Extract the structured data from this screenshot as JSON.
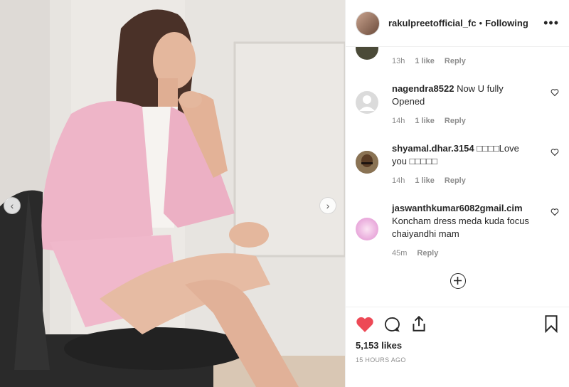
{
  "header": {
    "username": "rakulpreetofficial_fc",
    "separator": "•",
    "follow_status": "Following",
    "more_label": "•••"
  },
  "top_meta": {
    "time": "13h",
    "likes": "1 like",
    "reply": "Reply"
  },
  "comments": [
    {
      "username": "nagendra8522",
      "line1": "Now U fully",
      "line2": "Opened",
      "time": "14h",
      "likes": "1 like",
      "reply": "Reply"
    },
    {
      "username": "shyamal.dhar.3154",
      "line1": "□□□□Love",
      "line2": "you □□□□□",
      "time": "14h",
      "likes": "1 like",
      "reply": "Reply"
    },
    {
      "username": "jaswanthkumar6082gmail.cim",
      "line1": "Koncham dress meda kuda focus",
      "line2": "chaiyandhi mam",
      "time": "45m",
      "reply": "Reply"
    }
  ],
  "footer": {
    "likes": "5,153 likes",
    "time_ago": "15 HOURS AGO"
  },
  "colors": {
    "like_red": "#ed4956",
    "text": "#262626",
    "muted": "#8e8e8e",
    "blazer_pink": "#eeb5c8"
  },
  "icons": [
    "chevron-left-icon",
    "chevron-right-icon",
    "heart-icon",
    "comment-icon",
    "share-icon",
    "bookmark-icon",
    "add-icon",
    "more-icon"
  ]
}
